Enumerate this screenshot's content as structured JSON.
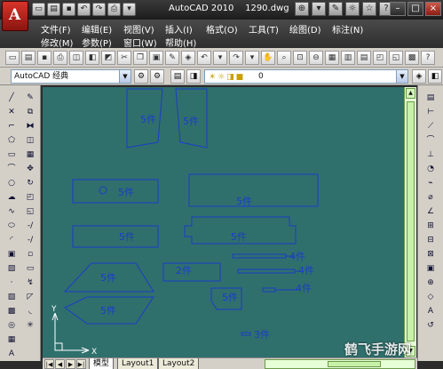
{
  "titlebar": {
    "app_title": "AutoCAD 2010",
    "file_name": "1290.dwg",
    "logo_letter": "A"
  },
  "menu": {
    "items": [
      {
        "label": "文件(F)"
      },
      {
        "label": "编辑(E)"
      },
      {
        "label": "视图(V)"
      },
      {
        "label": "插入(I)"
      },
      {
        "label": "格式(O)"
      },
      {
        "label": "工具(T)"
      },
      {
        "label": "绘图(D)"
      },
      {
        "label": "标注(N)"
      },
      {
        "label": "修改(M)"
      },
      {
        "label": "参数(P)"
      },
      {
        "label": "窗口(W)"
      },
      {
        "label": "帮助(H)"
      }
    ]
  },
  "toolbar": {
    "workspace": "AutoCAD 经典",
    "layer": "0"
  },
  "drawing": {
    "labels": [
      {
        "text": "5件"
      },
      {
        "text": "5件"
      },
      {
        "text": "5件"
      },
      {
        "text": "5件"
      },
      {
        "text": "5件"
      },
      {
        "text": "5件"
      },
      {
        "text": "2件"
      },
      {
        "text": "4件"
      },
      {
        "text": "4件"
      },
      {
        "text": "4件"
      },
      {
        "text": "5件"
      },
      {
        "text": "5件"
      },
      {
        "text": "3件"
      },
      {
        "text": "5件"
      }
    ],
    "ucs": {
      "x": "X",
      "y": "Y"
    }
  },
  "tabs": {
    "model": "模型",
    "layout1": "Layout1",
    "layout2": "Layout2"
  },
  "watermark": "鹤飞手游网",
  "colors": {
    "canvas": "#2f706c",
    "geometry": "#1a3cc8",
    "chrome": "#d4d0c8"
  }
}
